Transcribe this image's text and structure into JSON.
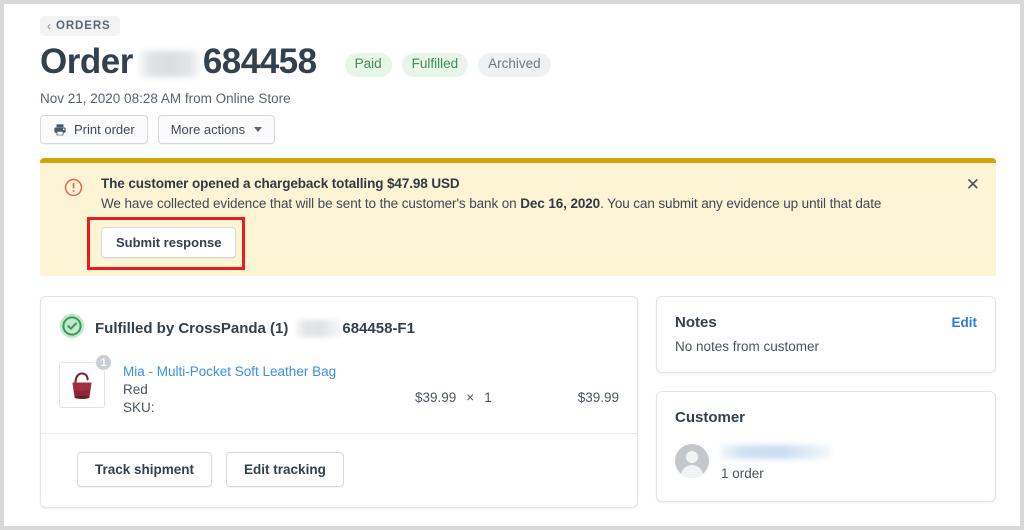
{
  "breadcrumb": {
    "chevron_icon": "chevron-left-icon",
    "label": "ORDERS"
  },
  "header": {
    "title_prefix": "Order",
    "order_number": "684458",
    "redacted": true,
    "badges": [
      {
        "label": "Paid",
        "kind": "success",
        "color": "#3f8f52"
      },
      {
        "label": "Fulfilled",
        "kind": "success",
        "color": "#3f8f52"
      },
      {
        "label": "Archived",
        "kind": "neutral",
        "color": "#6d7783"
      }
    ],
    "submeta": "Nov 21, 2020 08:28 AM from Online Store",
    "actions": [
      {
        "label": "Print order",
        "icon": "printer-icon"
      },
      {
        "label": "More actions",
        "icon": "chevron-down-icon"
      }
    ]
  },
  "banner": {
    "icon": "alert-circle-icon",
    "title": "The customer opened a chargeback totalling $47.98 USD",
    "body_before": "We have collected evidence that will be sent to the customer's bank on ",
    "body_date": "Dec 16, 2020",
    "body_after": ". You can submit any evidence up until that date",
    "button_label": "Submit response",
    "close_icon": "close-icon",
    "accent_color": "#d5a408",
    "background_color": "#fcf4d4",
    "highlight_color": "#ec1c1c"
  },
  "fulfillment": {
    "status_icon": "check-circle-icon",
    "title": "Fulfilled by CrossPanda (1)",
    "tracking_number": "684458-F1",
    "redacted": true,
    "item": {
      "thumbnail_icon": "handbag-thumbnail",
      "quantity_badge": "1",
      "name": "Mia - Multi-Pocket Soft Leather Bag",
      "variant": "Red",
      "sku_label": "SKU:",
      "unit_price": "$39.99",
      "multiplier": "×",
      "quantity": "1",
      "line_total": "$39.99"
    },
    "footer_buttons": [
      {
        "label": "Track shipment"
      },
      {
        "label": "Edit tracking"
      }
    ]
  },
  "notes_card": {
    "title": "Notes",
    "edit_label": "Edit",
    "body": "No notes from customer"
  },
  "customer_card": {
    "title": "Customer",
    "avatar_icon": "avatar-icon",
    "name_redacted": true,
    "order_count": "1 order"
  }
}
